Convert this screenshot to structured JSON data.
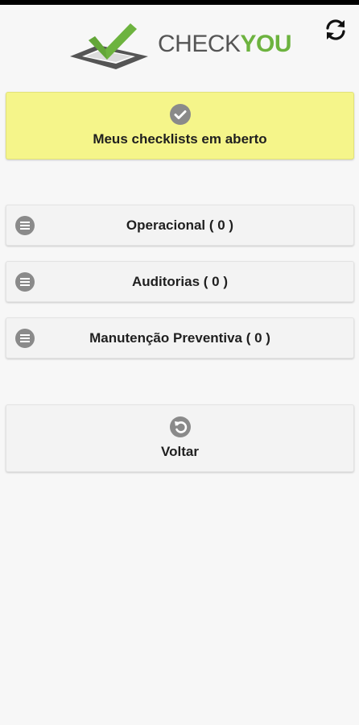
{
  "header": {
    "logo_text_part1": "CHECK",
    "logo_text_part2": "YOU",
    "logo_icon": "checkmark-box-icon",
    "sync_icon": "sync-icon"
  },
  "colors": {
    "brand_green": "#6db33f",
    "highlight_yellow": "#f5f58a",
    "icon_gray": "#8a8a8a"
  },
  "open_checklists": {
    "label": "Meus checklists em aberto",
    "icon": "check-circle-icon"
  },
  "categories": [
    {
      "label": "Operacional ( 0 )",
      "icon": "list-circle-icon"
    },
    {
      "label": "Auditorias ( 0 )",
      "icon": "list-circle-icon"
    },
    {
      "label": "Manutenção Preventiva ( 0 )",
      "icon": "list-circle-icon"
    }
  ],
  "back": {
    "label": "Voltar",
    "icon": "undo-circle-icon"
  }
}
